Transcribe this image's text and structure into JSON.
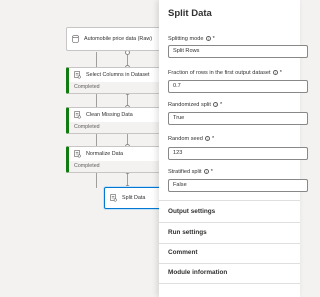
{
  "canvas": {
    "nodes": [
      {
        "label": "Automobile price data (Raw)",
        "status": ""
      },
      {
        "label": "Select Columns in Dataset",
        "status": "Completed"
      },
      {
        "label": "Clean Missing Data",
        "status": "Completed"
      },
      {
        "label": "Normalize Data",
        "status": "Completed"
      },
      {
        "label": "Split Data",
        "status": ""
      }
    ]
  },
  "panel": {
    "title": "Split Data",
    "fields": [
      {
        "label": "Splitting mode",
        "value": "Split Rows"
      },
      {
        "label": "Fraction of rows in the first output dataset",
        "value": "0.7"
      },
      {
        "label": "Randomized split",
        "value": "True"
      },
      {
        "label": "Random seed",
        "value": "123"
      },
      {
        "label": "Stratified split",
        "value": "False"
      }
    ],
    "required_mark": "*",
    "sections": [
      "Output settings",
      "Run settings",
      "Comment",
      "Module information"
    ]
  }
}
